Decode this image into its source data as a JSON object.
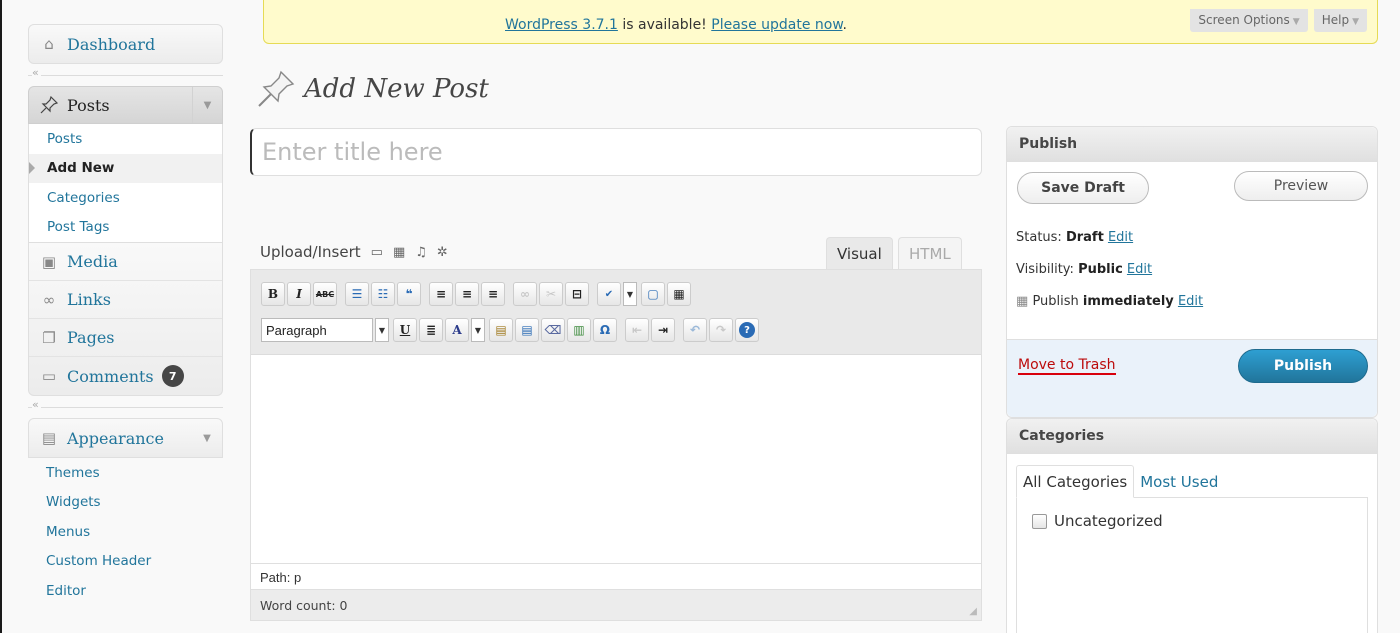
{
  "update_nag": {
    "version_link": "WordPress 3.7.1",
    "middle_text": " is available! ",
    "update_link": "Please update now",
    "end_text": "."
  },
  "screen_tabs": {
    "screen_options": "Screen Options",
    "help": "Help"
  },
  "sidebar": {
    "dashboard": "Dashboard",
    "posts": "Posts",
    "posts_sub": [
      "Posts",
      "Add New",
      "Categories",
      "Post Tags"
    ],
    "media": "Media",
    "links": "Links",
    "pages": "Pages",
    "comments": "Comments",
    "comments_count": "7",
    "appearance": "Appearance",
    "appearance_sub": [
      "Themes",
      "Widgets",
      "Menus",
      "Custom Header",
      "Editor"
    ],
    "collapse_glyph": "«"
  },
  "page_title": "Add New Post",
  "title_input": {
    "placeholder": "Enter title here",
    "value": ""
  },
  "editor": {
    "upload_label": "Upload/Insert",
    "tab_visual": "Visual",
    "tab_html": "HTML",
    "format_select": "Paragraph",
    "path": "Path: p",
    "word_count": "Word count: 0"
  },
  "publish": {
    "title": "Publish",
    "save_draft": "Save Draft",
    "preview": "Preview",
    "status_label": "Status: ",
    "status_value": "Draft",
    "visibility_label": "Visibility: ",
    "visibility_value": "Public",
    "publish_label": "Publish ",
    "publish_value": "immediately",
    "edit": "Edit",
    "move_to_trash": "Move to Trash",
    "publish_button": "Publish"
  },
  "categories": {
    "title": "Categories",
    "tab_all": "All Categories",
    "tab_most_used": "Most Used",
    "items": [
      "Uncategorized"
    ]
  },
  "colors": {
    "link": "#21759b",
    "nag_bg": "#fffbcc",
    "publish_button": "#21759b",
    "trash": "#bc0b0b"
  }
}
